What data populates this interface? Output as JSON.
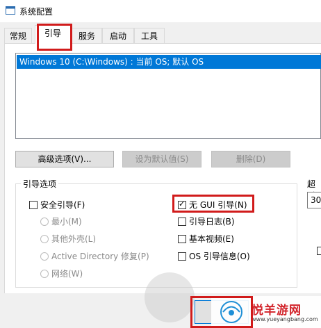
{
  "window": {
    "title": "系统配置"
  },
  "tabs": [
    {
      "label": "常规"
    },
    {
      "label": "引导"
    },
    {
      "label": "服务"
    },
    {
      "label": "启动"
    },
    {
      "label": "工具"
    }
  ],
  "os_list": {
    "items": [
      "Windows 10 (C:\\Windows) : 当前 OS; 默认 OS"
    ]
  },
  "buttons": {
    "advanced": "高级选项(V)...",
    "set_default": "设为默认值(S)",
    "delete": "删除(D)"
  },
  "boot_options": {
    "label": "引导选项",
    "safe_boot": "安全引导(F)",
    "radios": [
      "最小(M)",
      "其他外壳(L)",
      "Active Directory 修复(P)",
      "网络(W)"
    ],
    "no_gui": "无 GUI 引导(N)",
    "boot_log": "引导日志(B)",
    "base_video": "基本视频(E)",
    "os_boot_info": "OS 引导信息(O)"
  },
  "timeout": {
    "label": "超时",
    "value": "30"
  },
  "watermark": {
    "brand": "悦羊游网",
    "url": "www.yueyangbang.com"
  },
  "colors": {
    "selection": "#0078d7",
    "highlight_box": "#d11b1b",
    "brand": "#d2232a"
  }
}
